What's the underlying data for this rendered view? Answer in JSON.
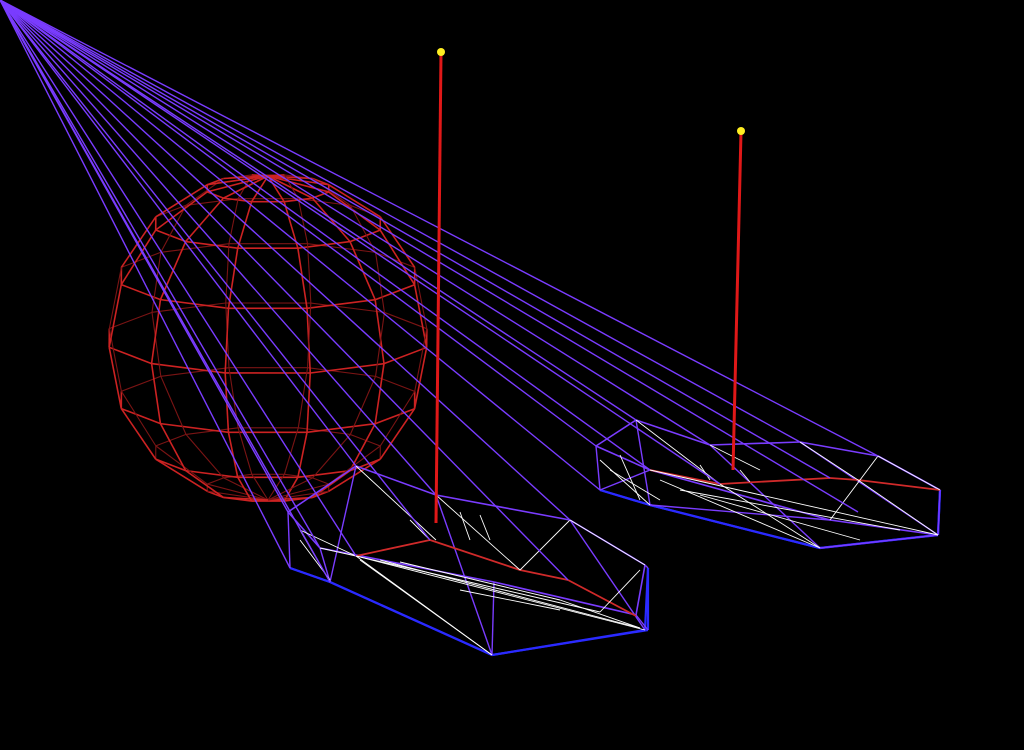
{
  "scene": {
    "background_color": "#000000",
    "render_mode": "wireframe",
    "objects": [
      {
        "name": "sphere",
        "edge_color": "#cc2222",
        "shape": "uv-sphere",
        "rings": 8,
        "segments": 12
      },
      {
        "name": "block-left",
        "edge_colors": [
          "#7a3cff",
          "#2a2aff",
          "#ffffff",
          "#d02a2a"
        ],
        "shape": "rounded-slab"
      },
      {
        "name": "block-right",
        "edge_colors": [
          "#7a3cff",
          "#2a2aff",
          "#ffffff",
          "#d02a2a"
        ],
        "shape": "rounded-slab"
      },
      {
        "name": "pole-left",
        "color": "#e01818",
        "tip_color": "#ffee22"
      },
      {
        "name": "pole-right",
        "color": "#e01818",
        "tip_color": "#ffee22"
      }
    ]
  }
}
